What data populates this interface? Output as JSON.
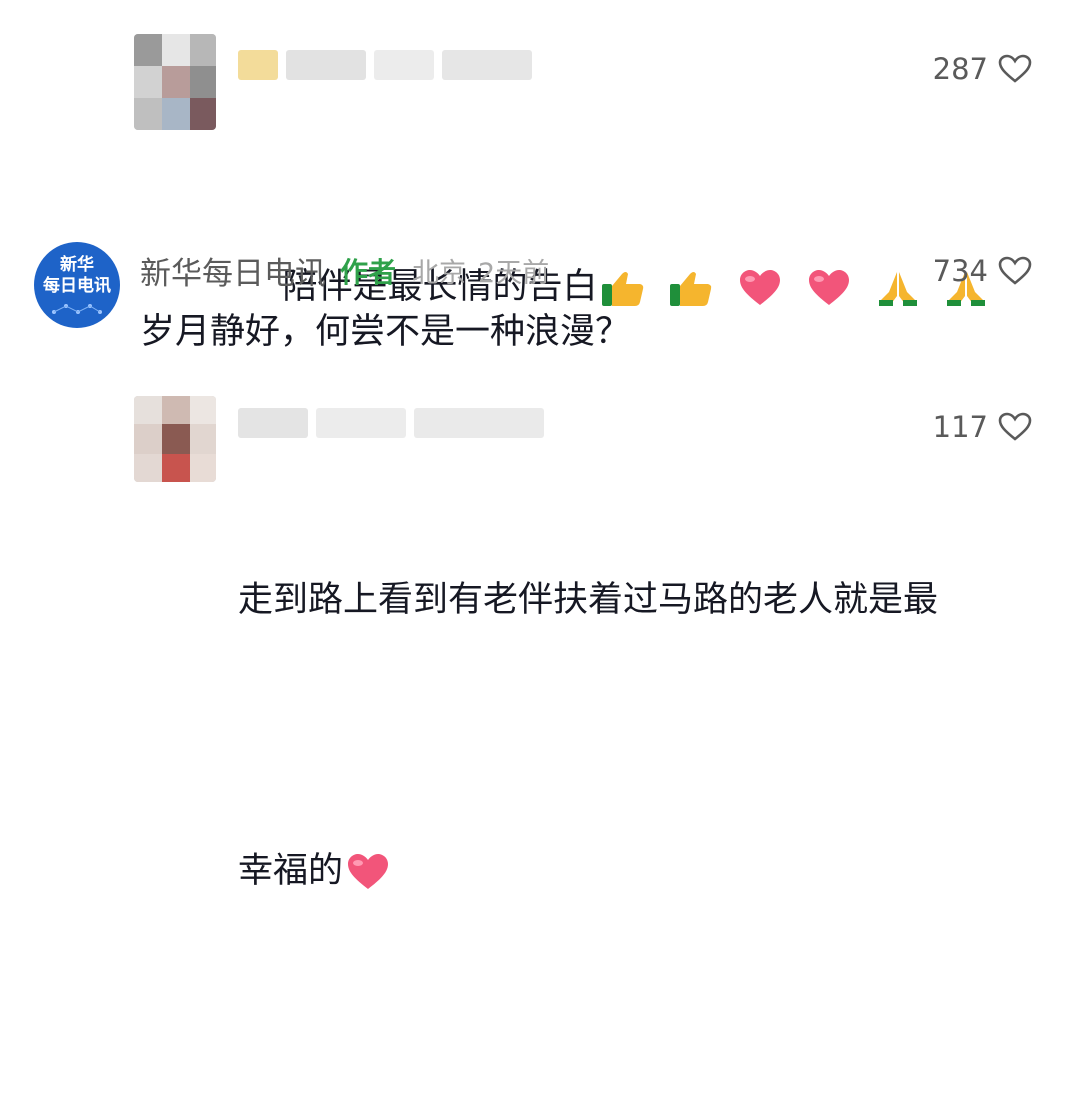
{
  "comments": [
    {
      "username": "",
      "text": "陪伴是最长情的告白",
      "emojis": [
        "thumbs-up-icon",
        "thumbs-up-icon",
        "heart-icon",
        "heart-icon",
        "pray-icon",
        "pray-icon"
      ],
      "likes": "287"
    },
    {
      "username": "新华每日电讯",
      "author_tag": "作者",
      "location": "北京",
      "time": "2天前",
      "text": "岁月静好，何尝不是一种浪漫？",
      "likes": "734",
      "avatar_text_line1": "新华",
      "avatar_text_line2": "每日电讯"
    },
    {
      "username": "",
      "text_line1": "走到路上看到有老伴扶着过马路的老人就是最",
      "text_line2": "幸福的",
      "emojis": [
        "heart-icon"
      ],
      "likes": "117"
    }
  ],
  "colors": {
    "author_tag": "#2fa14a",
    "avatar_blue": "#1e63c8",
    "heart_emoji": "#f2557a"
  }
}
